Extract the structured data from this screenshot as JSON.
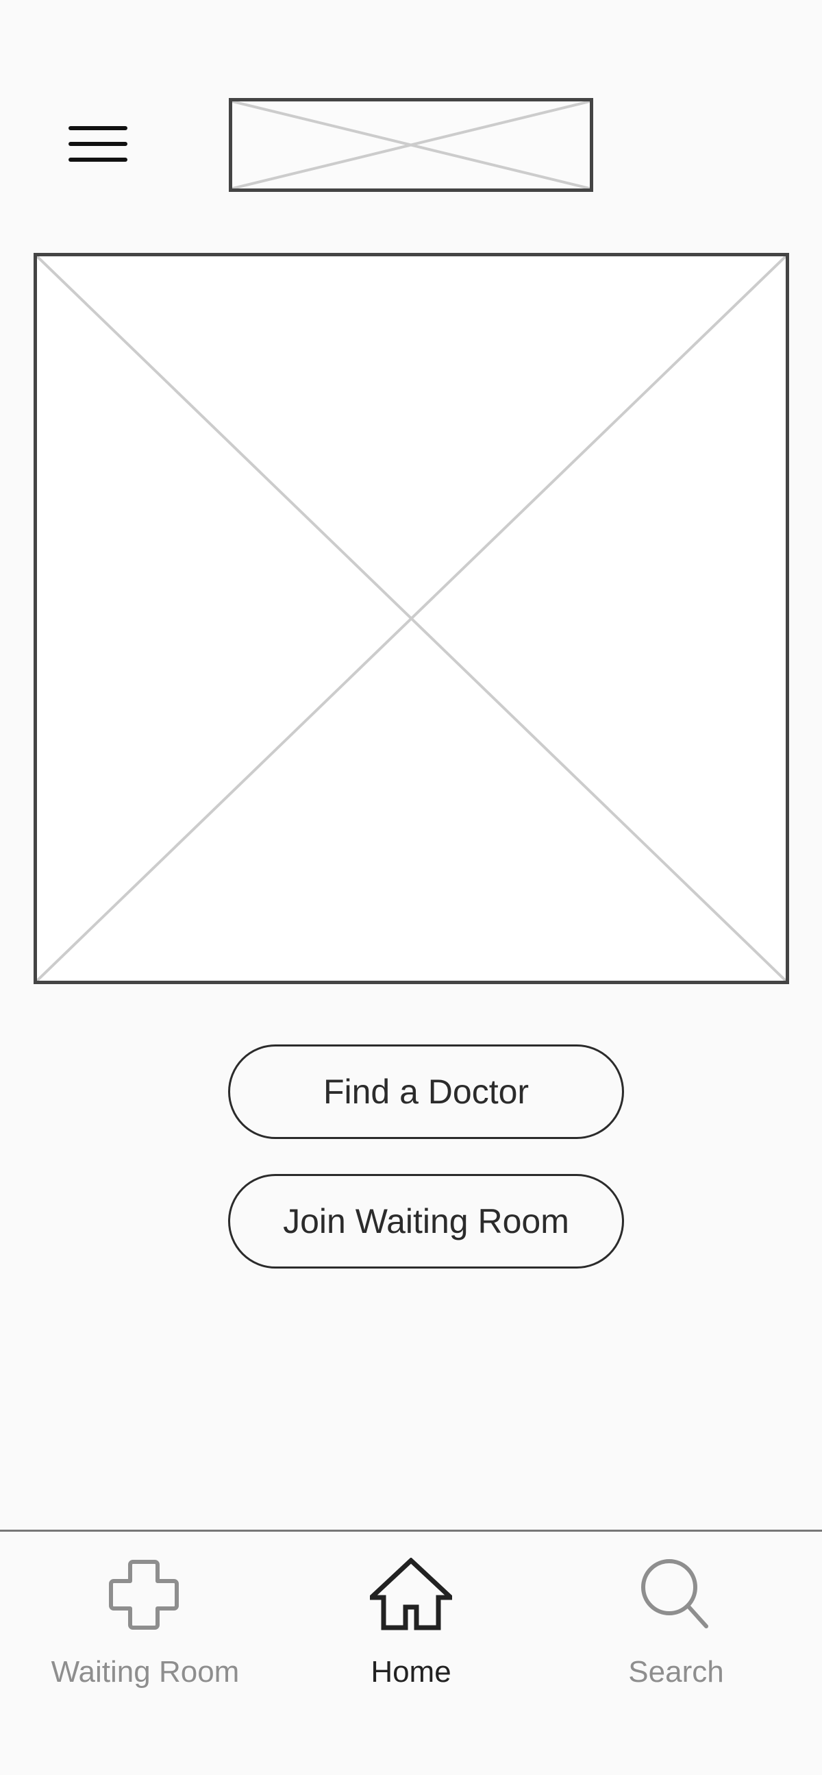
{
  "header": {
    "menu_icon": "hamburger-menu-icon",
    "logo": "image-placeholder"
  },
  "hero": {
    "image": "image-placeholder"
  },
  "actions": {
    "find_doctor_label": "Find a Doctor",
    "join_waiting_room_label": "Join Waiting Room"
  },
  "tab_bar": {
    "items": [
      {
        "label": "Waiting Room",
        "icon": "cross-icon",
        "active": false
      },
      {
        "label": "Home",
        "icon": "home-icon",
        "active": true
      },
      {
        "label": "Search",
        "icon": "search-icon",
        "active": false
      }
    ]
  },
  "colors": {
    "background": "#fafafa",
    "border": "#444444",
    "placeholder_cross": "#cccccc",
    "active_text": "#222222",
    "inactive_text": "#8e8e8e"
  }
}
